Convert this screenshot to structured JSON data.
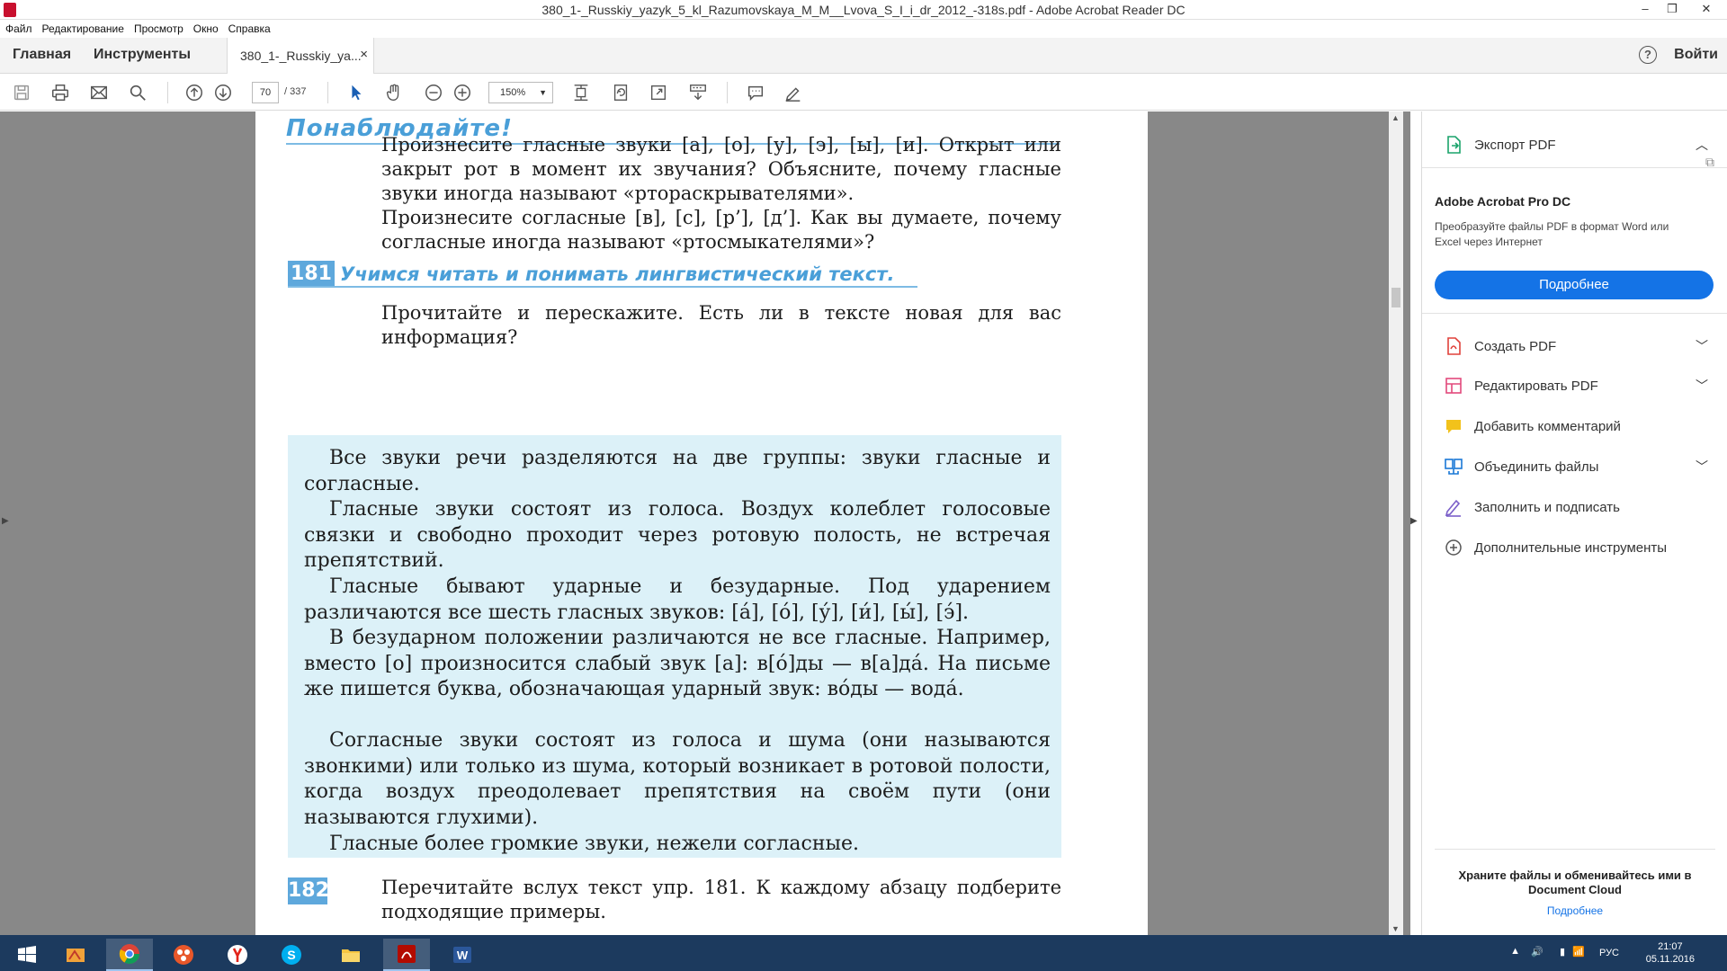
{
  "window": {
    "title": "380_1-_Russkiy_yazyk_5_kl_Razumovskaya_M_M__Lvova_S_I_i_dr_2012_-318s.pdf - Adobe Acrobat Reader DC",
    "min": "–",
    "restore": "❐",
    "close": "✕"
  },
  "menu": [
    "Файл",
    "Редактирование",
    "Просмотр",
    "Окно",
    "Справка"
  ],
  "tabs": {
    "home": "Главная",
    "tools": "Инструменты",
    "document": "380_1-_Russkiy_ya...",
    "close": "×",
    "help": "?",
    "login": "Войти"
  },
  "toolbar": {
    "page_current": "70",
    "page_total": "/ 337",
    "zoom": "150%"
  },
  "page": {
    "observe_heading": "Понаблюдайте!",
    "observe_p1": "Произнесите гласные звуки [а], [о], [у], [э], [ы], [и]. Открыт или закрыт рот в момент их звучания? Объясните, почему гласные звуки иногда называют «ртораскрывателями».",
    "observe_p2": "Произнесите согласные [в], [с], [р’], [д’]. Как вы думаете, почему согласные иногда называют «ртосмыкателями»?",
    "ex181_num": "181",
    "ex181_title": "Учимся читать и понимать лингвистический текст.",
    "ex181_task": "Прочитайте и перескажите. Есть ли в тексте новая для вас информация?",
    "theory": [
      "Все звуки речи разделяются на две группы: звуки гласные и согласные.",
      "Гласные звуки состоят из голоса. Воздух колеблет голосовые связки и свободно проходит через ротовую полость, не встречая препятствий.",
      "Гласные бывают ударные и безударные. Под ударением различаются все шесть гласных звуков: [а́], [о́], [у́], [и́], [ы́], [э́].",
      "В безударном положении различаются не все гласные. Например, вместо [о] произносится слабый звук [а]: в[о́]ды — в[а]да́. На письме же пишется буква, обозначающая ударный звук: во́ды — вода́.",
      "Согласные звуки состоят из голоса и шума (они называются звонкими) или только из шума, который возникает в ротовой полости, когда воздух преодолевает препятствия на своём пути (они называются глухими).",
      "Гласные более громкие звуки, нежели согласные."
    ],
    "ex182_num": "182",
    "ex182_text": "Перечитайте вслух текст упр. 181. К каждому абзацу подберите подходящие примеры."
  },
  "sidebar": {
    "export": "Экспорт PDF",
    "promo_title": "Adobe Acrobat Pro DC",
    "promo_text": "Преобразуйте файлы PDF в формат Word или Excel через Интернет",
    "promo_button": "Подробнее",
    "items": [
      {
        "label": "Создать PDF",
        "icon": "create-pdf-icon",
        "color": "#e0413a"
      },
      {
        "label": "Редактировать PDF",
        "icon": "edit-pdf-icon",
        "color": "#e2497c"
      },
      {
        "label": "Добавить комментарий",
        "icon": "comment-icon",
        "color": "#f2c21b"
      },
      {
        "label": "Объединить файлы",
        "icon": "combine-icon",
        "color": "#1a78d6"
      },
      {
        "label": "Заполнить и подписать",
        "icon": "fill-sign-icon",
        "color": "#7b5fc9"
      },
      {
        "label": "Дополнительные инструменты",
        "icon": "more-tools-icon",
        "color": "#555555"
      }
    ],
    "cloud_text": "Храните файлы и обменивайтесь ими в Document Cloud",
    "cloud_link": "Подробнее"
  },
  "taskbar": {
    "lang": "РУС",
    "time": "21:07",
    "date": "05.11.2016"
  },
  "colors": {
    "accent": "#1473e6",
    "heading_blue": "#4a9fd8",
    "theory_bg": "#dcf1f8",
    "taskbar": "#1c3a5e"
  }
}
